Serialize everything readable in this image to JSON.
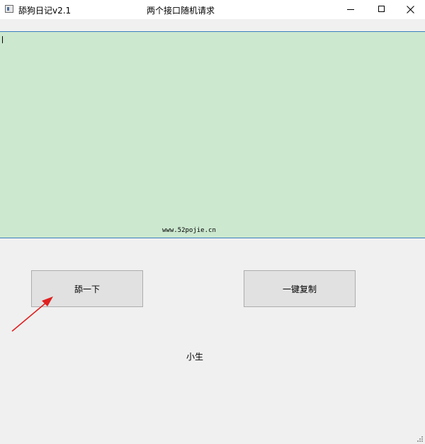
{
  "window": {
    "app_title": "舔狗日记v2.1",
    "center_title": "两个接口随机请求",
    "icons": {
      "app": "app-window-icon",
      "minimize": "minimize-icon",
      "maximize": "maximize-icon",
      "close": "close-icon"
    }
  },
  "content": {
    "textarea_value": "",
    "watermark": "www.52pojie.cn",
    "colors": {
      "textarea_bg": "#cce8cf",
      "textarea_border": "#3c7fc0",
      "arrow": "#e02020"
    }
  },
  "buttons": {
    "lick_label": "舔一下",
    "copy_label": "一键复制"
  },
  "footer": {
    "label": "小生"
  }
}
